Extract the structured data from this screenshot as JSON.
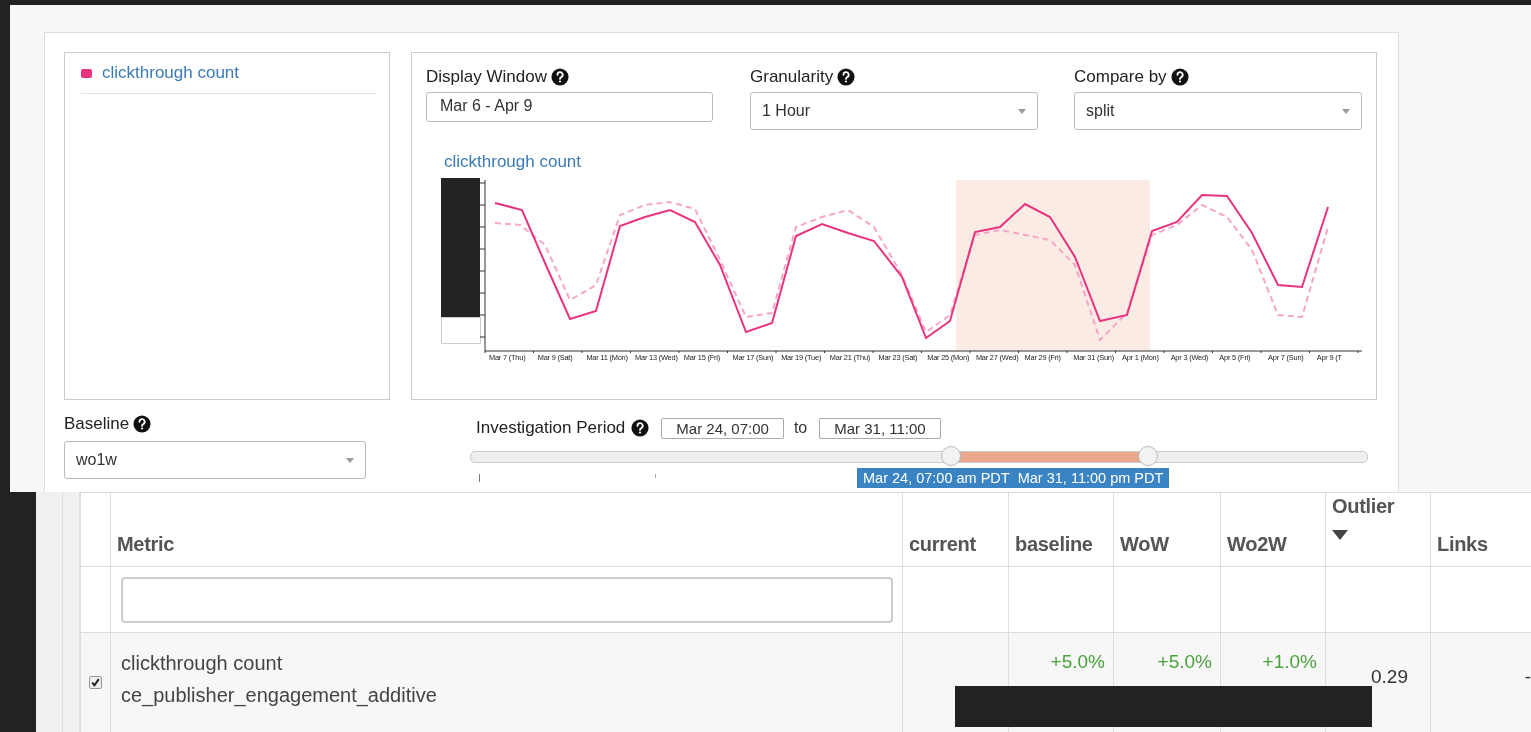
{
  "legend": {
    "items": [
      {
        "label": "clickthrough count",
        "color": "#e8337f"
      }
    ]
  },
  "controls": [
    {
      "kind": "text",
      "label": "Display Window",
      "value": "Mar 6 - Apr 9"
    },
    {
      "kind": "select",
      "label": "Granularity",
      "value": "1 Hour"
    },
    {
      "kind": "select",
      "label": "Compare by",
      "value": "split"
    }
  ],
  "chart": {
    "title": "clickthrough count",
    "x_labels": [
      "Mar 7 (Thu)",
      "Mar 9 (Sat)",
      "Mar 11 (Mon)",
      "Mar 13 (Wed)",
      "Mar 15 (Fri)",
      "Mar 17 (Sun)",
      "Mar 19 (Tue)",
      "Mar 21 (Thu)",
      "Mar 23 (Sat)",
      "Mar 25 (Mon)",
      "Mar 27 (Wed)",
      "Mar 29 (Fri)",
      "Mar 31 (Sun)",
      "Apr 1 (Mon)",
      "Apr 3 (Wed)",
      "Apr 5 (Fri)",
      "Apr 7 (Sun)",
      "Apr 9 (T"
    ]
  },
  "baseline": {
    "label": "Baseline",
    "value": "wo1w"
  },
  "investigation": {
    "label": "Investigation Period",
    "start": "Mar 24, 07:00",
    "to": "to",
    "end": "Mar 31, 11:00",
    "thumbs": [
      {
        "level": 0.536
      },
      {
        "level": 0.756
      }
    ],
    "tooltip": [
      "Mar 24, 07:00 am PDT",
      "Mar 31, 11:00 pm PDT"
    ]
  },
  "table": {
    "columns": [
      {
        "label": "Metric",
        "sorted": false
      },
      {
        "label": "current",
        "sorted": false
      },
      {
        "label": "baseline",
        "sorted": false
      },
      {
        "label": "WoW",
        "sorted": false
      },
      {
        "label": "Wo2W",
        "sorted": false
      },
      {
        "label": "Outlier",
        "sorted": true
      },
      {
        "label": "Links",
        "sorted": false
      }
    ],
    "rows": [
      {
        "checked": true,
        "metric": "clickthrough count",
        "dataset": "ce_publisher_engagement_additive",
        "baseline": "+5.0%",
        "wow": "+5.0%",
        "wo2w": "+1.0%",
        "outlier": "0.29",
        "links": "-"
      }
    ]
  }
}
